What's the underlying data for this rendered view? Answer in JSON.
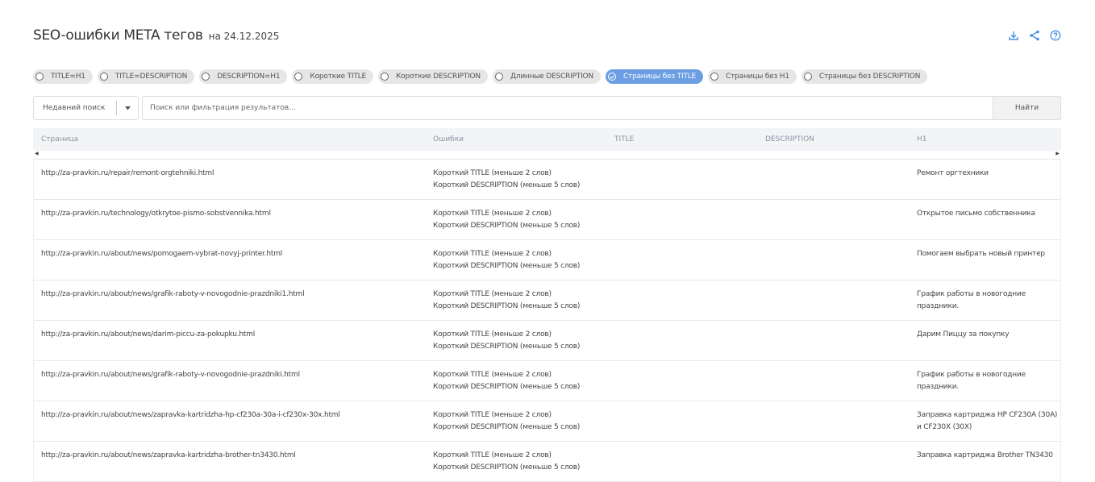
{
  "header": {
    "title": "SEO-ошибки META тегов",
    "date": "на 24.12.2025"
  },
  "filters": [
    {
      "label": "TITLE=H1",
      "active": false
    },
    {
      "label": "TITLE=DESCRIPTION",
      "active": false
    },
    {
      "label": "DESCRIPTION=H1",
      "active": false
    },
    {
      "label": "Короткие TITLE",
      "active": false
    },
    {
      "label": "Короткие DESCRIPTION",
      "active": false
    },
    {
      "label": "Длинные DESCRIPTION",
      "active": false
    },
    {
      "label": "Страницы без TITLE",
      "active": true
    },
    {
      "label": "Страницы без H1",
      "active": false
    },
    {
      "label": "Страницы без DESCRIPTION",
      "active": false
    }
  ],
  "search": {
    "recent_label": "Недавний поиск",
    "placeholder": "Поиск или фильтрация результатов...",
    "value": "",
    "button": "Найти"
  },
  "table": {
    "columns": [
      "Страница",
      "Ошибки",
      "TITLE",
      "DESCRIPTION",
      "H1"
    ],
    "rows": [
      {
        "page": "http://za-pravkin.ru/repair/remont-orgtehniki.html",
        "errors": [
          "Короткий TITLE (меньше 2 слов)",
          "Короткий DESCRIPTION (меньше 5 слов)"
        ],
        "title": "",
        "description": "",
        "h1": "Ремонт оргтехники"
      },
      {
        "page": "http://za-pravkin.ru/technology/otkrytoe-pismo-sobstvennika.html",
        "errors": [
          "Короткий TITLE (меньше 2 слов)",
          "Короткий DESCRIPTION (меньше 5 слов)"
        ],
        "title": "",
        "description": "",
        "h1": "Открытое письмо собственника"
      },
      {
        "page": "http://za-pravkin.ru/about/news/pomogaem-vybrat-novyj-printer.html",
        "errors": [
          "Короткий TITLE (меньше 2 слов)",
          "Короткий DESCRIPTION (меньше 5 слов)"
        ],
        "title": "",
        "description": "",
        "h1": "Помогаем выбрать новый принтер"
      },
      {
        "page": "http://za-pravkin.ru/about/news/grafik-raboty-v-novogodnie-prazdniki1.html",
        "errors": [
          "Короткий TITLE (меньше 2 слов)",
          "Короткий DESCRIPTION (меньше 5 слов)"
        ],
        "title": "",
        "description": "",
        "h1": "График работы в новогодние праздники."
      },
      {
        "page": "http://za-pravkin.ru/about/news/darim-piccu-za-pokupku.html",
        "errors": [
          "Короткий TITLE (меньше 2 слов)",
          "Короткий DESCRIPTION (меньше 5 слов)"
        ],
        "title": "",
        "description": "",
        "h1": "Дарим Пиццу за покупку"
      },
      {
        "page": "http://za-pravkin.ru/about/news/grafik-raboty-v-novogodnie-prazdniki.html",
        "errors": [
          "Короткий TITLE (меньше 2 слов)",
          "Короткий DESCRIPTION (меньше 5 слов)"
        ],
        "title": "",
        "description": "",
        "h1": "График работы в новогодние праздники."
      },
      {
        "page": "http://za-pravkin.ru/about/news/zapravka-kartridzha-hp-cf230a-30a-i-cf230x-30x.html",
        "errors": [
          "Короткий TITLE (меньше 2 слов)",
          "Короткий DESCRIPTION (меньше 5 слов)"
        ],
        "title": "",
        "description": "",
        "h1": "Заправка картриджа HP CF230A (30A) и CF230X (30X)"
      },
      {
        "page": "http://za-pravkin.ru/about/news/zapravka-kartridzha-brother-tn3430.html",
        "errors": [
          "Короткий TITLE (меньше 2 слов)",
          "Короткий DESCRIPTION (меньше 5 слов)"
        ],
        "title": "",
        "description": "",
        "h1": "Заправка картриджа Brother TN3430"
      }
    ]
  },
  "colors": {
    "accent": "#6b9ee2",
    "icon": "#4a8fe0",
    "chip_bg": "#e6e6e6",
    "header_bg": "#f3f4f6"
  },
  "icons": [
    "download-icon",
    "share-icon",
    "help-icon",
    "chevron-down-icon",
    "check-icon",
    "scroll-left-icon",
    "scroll-right-icon"
  ]
}
